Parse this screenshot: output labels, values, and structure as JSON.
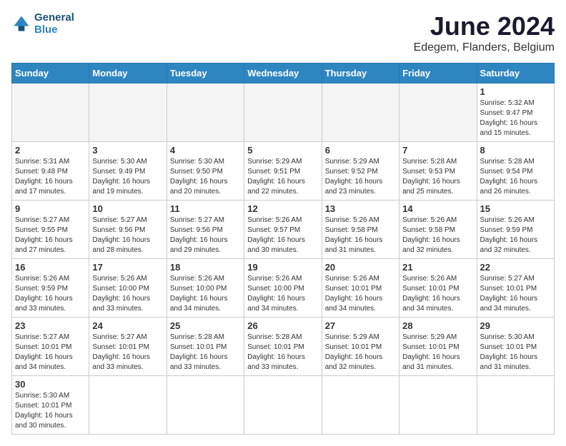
{
  "logo": {
    "text_general": "General",
    "text_blue": "Blue"
  },
  "title": {
    "month_year": "June 2024",
    "location": "Edegem, Flanders, Belgium"
  },
  "weekdays": [
    "Sunday",
    "Monday",
    "Tuesday",
    "Wednesday",
    "Thursday",
    "Friday",
    "Saturday"
  ],
  "days": [
    {
      "number": "",
      "info": ""
    },
    {
      "number": "",
      "info": ""
    },
    {
      "number": "",
      "info": ""
    },
    {
      "number": "",
      "info": ""
    },
    {
      "number": "",
      "info": ""
    },
    {
      "number": "",
      "info": ""
    },
    {
      "number": "1",
      "info": "Sunrise: 5:32 AM\nSunset: 9:47 PM\nDaylight: 16 hours and 15 minutes."
    },
    {
      "number": "2",
      "info": "Sunrise: 5:31 AM\nSunset: 9:48 PM\nDaylight: 16 hours and 17 minutes."
    },
    {
      "number": "3",
      "info": "Sunrise: 5:30 AM\nSunset: 9:49 PM\nDaylight: 16 hours and 19 minutes."
    },
    {
      "number": "4",
      "info": "Sunrise: 5:30 AM\nSunset: 9:50 PM\nDaylight: 16 hours and 20 minutes."
    },
    {
      "number": "5",
      "info": "Sunrise: 5:29 AM\nSunset: 9:51 PM\nDaylight: 16 hours and 22 minutes."
    },
    {
      "number": "6",
      "info": "Sunrise: 5:29 AM\nSunset: 9:52 PM\nDaylight: 16 hours and 23 minutes."
    },
    {
      "number": "7",
      "info": "Sunrise: 5:28 AM\nSunset: 9:53 PM\nDaylight: 16 hours and 25 minutes."
    },
    {
      "number": "8",
      "info": "Sunrise: 5:28 AM\nSunset: 9:54 PM\nDaylight: 16 hours and 26 minutes."
    },
    {
      "number": "9",
      "info": "Sunrise: 5:27 AM\nSunset: 9:55 PM\nDaylight: 16 hours and 27 minutes."
    },
    {
      "number": "10",
      "info": "Sunrise: 5:27 AM\nSunset: 9:56 PM\nDaylight: 16 hours and 28 minutes."
    },
    {
      "number": "11",
      "info": "Sunrise: 5:27 AM\nSunset: 9:56 PM\nDaylight: 16 hours and 29 minutes."
    },
    {
      "number": "12",
      "info": "Sunrise: 5:26 AM\nSunset: 9:57 PM\nDaylight: 16 hours and 30 minutes."
    },
    {
      "number": "13",
      "info": "Sunrise: 5:26 AM\nSunset: 9:58 PM\nDaylight: 16 hours and 31 minutes."
    },
    {
      "number": "14",
      "info": "Sunrise: 5:26 AM\nSunset: 9:58 PM\nDaylight: 16 hours and 32 minutes."
    },
    {
      "number": "15",
      "info": "Sunrise: 5:26 AM\nSunset: 9:59 PM\nDaylight: 16 hours and 32 minutes."
    },
    {
      "number": "16",
      "info": "Sunrise: 5:26 AM\nSunset: 9:59 PM\nDaylight: 16 hours and 33 minutes."
    },
    {
      "number": "17",
      "info": "Sunrise: 5:26 AM\nSunset: 10:00 PM\nDaylight: 16 hours and 33 minutes."
    },
    {
      "number": "18",
      "info": "Sunrise: 5:26 AM\nSunset: 10:00 PM\nDaylight: 16 hours and 34 minutes."
    },
    {
      "number": "19",
      "info": "Sunrise: 5:26 AM\nSunset: 10:00 PM\nDaylight: 16 hours and 34 minutes."
    },
    {
      "number": "20",
      "info": "Sunrise: 5:26 AM\nSunset: 10:01 PM\nDaylight: 16 hours and 34 minutes."
    },
    {
      "number": "21",
      "info": "Sunrise: 5:26 AM\nSunset: 10:01 PM\nDaylight: 16 hours and 34 minutes."
    },
    {
      "number": "22",
      "info": "Sunrise: 5:27 AM\nSunset: 10:01 PM\nDaylight: 16 hours and 34 minutes."
    },
    {
      "number": "23",
      "info": "Sunrise: 5:27 AM\nSunset: 10:01 PM\nDaylight: 16 hours and 34 minutes."
    },
    {
      "number": "24",
      "info": "Sunrise: 5:27 AM\nSunset: 10:01 PM\nDaylight: 16 hours and 33 minutes."
    },
    {
      "number": "25",
      "info": "Sunrise: 5:28 AM\nSunset: 10:01 PM\nDaylight: 16 hours and 33 minutes."
    },
    {
      "number": "26",
      "info": "Sunrise: 5:28 AM\nSunset: 10:01 PM\nDaylight: 16 hours and 33 minutes."
    },
    {
      "number": "27",
      "info": "Sunrise: 5:29 AM\nSunset: 10:01 PM\nDaylight: 16 hours and 32 minutes."
    },
    {
      "number": "28",
      "info": "Sunrise: 5:29 AM\nSunset: 10:01 PM\nDaylight: 16 hours and 31 minutes."
    },
    {
      "number": "29",
      "info": "Sunrise: 5:30 AM\nSunset: 10:01 PM\nDaylight: 16 hours and 31 minutes."
    },
    {
      "number": "30",
      "info": "Sunrise: 5:30 AM\nSunset: 10:01 PM\nDaylight: 16 hours and 30 minutes."
    }
  ]
}
